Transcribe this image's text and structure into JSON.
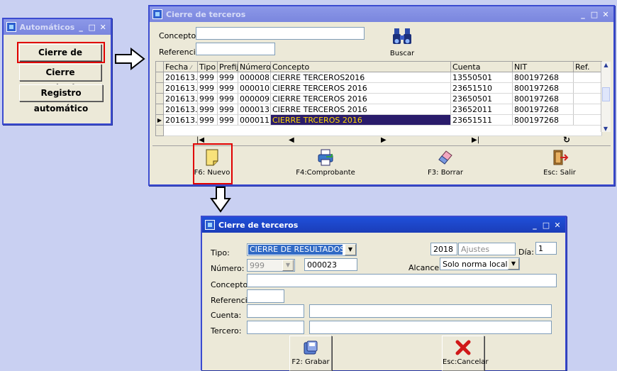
{
  "win_auto": {
    "title": "Automáticos",
    "buttons": [
      "Cierre de terceros",
      "Cierre resultados",
      "Registro automático"
    ]
  },
  "win_cierre": {
    "title": "Cierre de terceros",
    "concepto_label": "Concepto:",
    "referencia_label": "Referencia:",
    "concepto_value": "",
    "referencia_value": "",
    "buscar_label": "Buscar",
    "columns": [
      "Fecha",
      "Tipo",
      "Prefijo",
      "Número",
      "Concepto",
      "Cuenta",
      "NIT",
      "Ref."
    ],
    "rows": [
      [
        "201613...",
        "999",
        "999",
        "000008",
        "CIERRE TERCEROS2016",
        "13550501",
        "800197268",
        ""
      ],
      [
        "201613...",
        "999",
        "999",
        "000010",
        "CIERRE TERCEROS 2016",
        "23651510",
        "800197268",
        ""
      ],
      [
        "201613...",
        "999",
        "999",
        "000009",
        "CIERRE TERCEROS 2016",
        "23650501",
        "800197268",
        ""
      ],
      [
        "201613...",
        "999",
        "999",
        "000013",
        "CIERRE TERCEROS 2016",
        "23652011",
        "800197268",
        ""
      ],
      [
        "201613...",
        "999",
        "999",
        "000011",
        "CIERRE TRCEROS 2016",
        "23651511",
        "800197268",
        ""
      ]
    ],
    "toolbar": [
      "F6: Nuevo",
      "F4:Comprobante",
      "F3: Borrar",
      "Esc: Salir"
    ]
  },
  "win_form": {
    "title": "Cierre de terceros",
    "tipo_label": "Tipo:",
    "tipo_value": "CIERRE DE RESULTADOS",
    "year": "2018",
    "ajustes": "Ajustes",
    "dia_label": "Día:",
    "dia_value": "1",
    "numero_label": "Número:",
    "prefijo_value": "999",
    "numero_value": "000023",
    "alcance_label": "Alcance:",
    "alcance_value": "Solo norma local",
    "concepto_label": "Concepto:",
    "referencia_label": "Referencia:",
    "cuenta_label": "Cuenta:",
    "tercero_label": "Tercero:",
    "grabar_label": "F2: Grabar",
    "cancelar_label": "Esc:Cancelar"
  }
}
